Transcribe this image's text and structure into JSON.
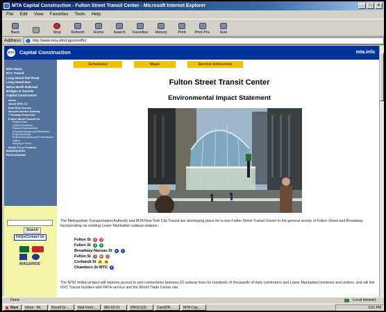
{
  "window": {
    "title": "MTA Capital Construction - Fulton Street Transit Center - Microsoft Internet Explorer"
  },
  "menu": [
    "File",
    "Edit",
    "View",
    "Favorites",
    "Tools",
    "Help"
  ],
  "toolbar": [
    "Back",
    "",
    "Stop",
    "Refresh",
    "Home",
    "Search",
    "Favorites",
    "History",
    "Print",
    "Print Pre.",
    "Size"
  ],
  "address": {
    "label": "Address",
    "url": "http://www.mta.info/capconn/ftc/"
  },
  "site": {
    "logo": "MTA",
    "title": "Capital Construction",
    "home_link": "mta.info"
  },
  "nav": {
    "top_items": [
      "MTA Home",
      "NYC Transit",
      "Long Island Rail Road",
      "Long Island Bus",
      "Metro-North Railroad",
      "Bridges & Tunnels"
    ],
    "section": "Capital Construction",
    "sub_items": [
      "Home",
      "About MTA CC",
      "East Side Access",
      "Second Avenue Subway",
      "7 Subway Extension",
      "Fulton Street Transit Ctr"
    ],
    "ftc_items": [
      "Project Goals",
      "Current Conditions",
      "Planned Improvements",
      "Schedule Impacts and Restrictions",
      "Project Schedule",
      "Project Documents and Presentations",
      "Gallery",
      "Keeping in Touch"
    ],
    "bottom_items": [
      "South Ferry Terminal",
      "Employment",
      "Procurement"
    ],
    "search_button": "Search",
    "faq_link": "FAQs/Contact Us",
    "mag_ride": "MAG&RIDE"
  },
  "tabs": [
    "Schedules",
    "Maps",
    "Service Advisories"
  ],
  "page": {
    "title": "Fulton Street Transit Center",
    "subtitle": "Environmental Impact Statement",
    "intro": "The Metropolitan Transportation Authority and MTA New York City Transit are developing plans for a new Fulton Street Transit Center in the general vicinity of Fulton Street and Broadway, incorporating six existing Lower Manhattan subway stations:",
    "stations": [
      {
        "name": "Fulton St",
        "lines": [
          "2",
          "3"
        ],
        "color": "#e53935"
      },
      {
        "name": "Fulton St",
        "lines": [
          "4",
          "5"
        ],
        "color": "#00933c"
      },
      {
        "name": "Broadway-Nassau St",
        "lines": [
          "A",
          "C"
        ],
        "color": "#0039a6"
      },
      {
        "name": "Fulton St",
        "lines": [
          "J",
          "M",
          "Z"
        ],
        "color": "#996633"
      },
      {
        "name": "Cortlandt St",
        "lines": [
          "R",
          "W"
        ],
        "color": "#fccc0a"
      },
      {
        "name": "Chambers St-WTC",
        "lines": [
          "E"
        ],
        "color": "#0039a6"
      }
    ],
    "project": "The $750 million project will improve access to and connections between 12 subway lines for hundreds of thousands of daily commuters and Lower Manhattan residents and visitors, and will link NYC Transit facilities with PATH service and the World Trade Center site."
  },
  "status": {
    "left": "Done",
    "zone": "Local intranet"
  },
  "taskbar": {
    "start": "Start",
    "tasks": [
      "Inbox - Mi...",
      "Novell Gr...",
      "Mail From...",
      "MG-03-01",
      "WKS12(2)",
      "CorelDR...",
      "MTA Cap..."
    ],
    "clock": "3:51 PM"
  }
}
